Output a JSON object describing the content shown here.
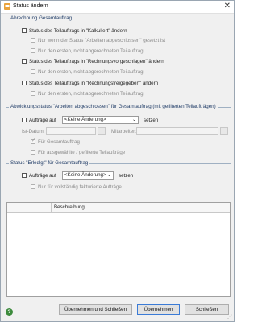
{
  "window": {
    "title": "Status ändern",
    "close_glyph": "✕",
    "icon": "app-icon"
  },
  "group_abrechnung": {
    "title": "Abrechnung Gesamtauftrag",
    "kalkuliert": "Status des Teilauftrags in \"Kalkuliert\" ändern",
    "nur_wenn": "Nur wenn der Status \"Arbeiten abgeschlossen\" gesetzt ist",
    "nur_ersten_1": "Nur den ersten, nicht abgerechneten Teilauftrag",
    "rechnungsvorgeschlagen": "Status des Teilauftrags in \"Rechnungsvorgeschlagen\" ändern",
    "nur_ersten_2": "Nur den ersten, nicht abgerechneten Teilauftrag",
    "rechnungsfreigegeben": "Status des Teilauftrags in \"Rechnungsfreigegeben\" ändern",
    "nur_ersten_3": "Nur den ersten, nicht abgerechneten Teilauftrag"
  },
  "group_abwicklung": {
    "title": "Abwicklungsstatus \"Arbeiten abgeschlossen\" für Gesamtauftrag (mit gefilterten Teilaufträgen)",
    "auftraege_auf": "Aufträge auf",
    "dropdown_value": "<Keine Änderung>",
    "setzen": "setzen",
    "ist_datum": "Ist-Datum:",
    "mitarbeiter": "Mitarbeiter:",
    "fuer_gesamtauftrag": "Für Gesamtauftrag",
    "fuer_ausgewaehlte": "Für ausgewählte / gefilterte Teilaufträge"
  },
  "group_erledigt": {
    "title": "Status \"Erledigt\" für Gesamtauftrag",
    "auftraege_auf": "Aufträge auf",
    "dropdown_value": "<Keine Änderung>",
    "setzen": "setzen",
    "nur_vollstaendig": "Nur für vollständig fakturierte Aufträge"
  },
  "table": {
    "column_beschreibung": "Beschreibung"
  },
  "footer": {
    "help": "?",
    "btn_uebernehmen_schliessen": "Übernehmen und Schließen",
    "btn_uebernehmen": "Übernehmen",
    "btn_schliessen": "Schließen"
  },
  "colors": {
    "group_title": "#1f3b66",
    "help_green": "#3d8b3d",
    "default_button_border": "#3b7bd6"
  }
}
